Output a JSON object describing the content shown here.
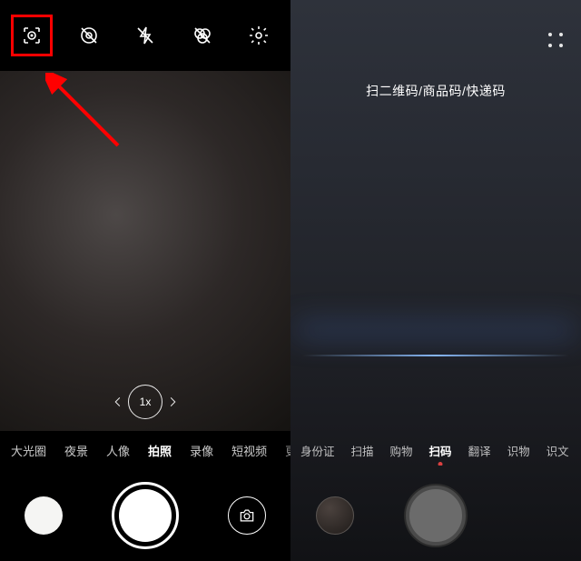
{
  "left": {
    "toolbar_icons": [
      "ai-lens",
      "live-off",
      "flash-off",
      "filter-off",
      "settings"
    ],
    "zoom": "1x",
    "modes": [
      "大光圈",
      "夜景",
      "人像",
      "拍照",
      "录像",
      "短视频",
      "更多"
    ],
    "active_mode_index": 3
  },
  "right": {
    "title": "扫二维码/商品码/快递码",
    "modes": [
      "身份证",
      "扫描",
      "购物",
      "扫码",
      "翻译",
      "识物",
      "识文"
    ],
    "active_mode_index": 3
  }
}
